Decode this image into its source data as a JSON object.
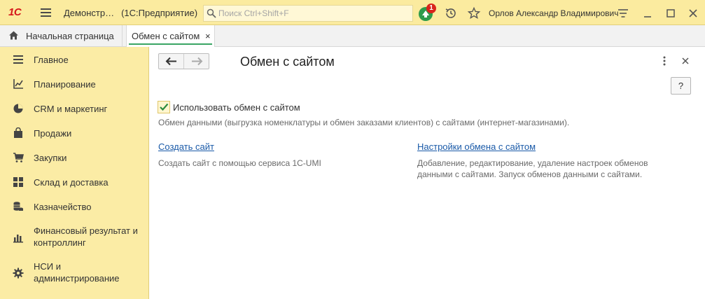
{
  "topbar": {
    "logo": "1С",
    "app_title": "Демонстр…",
    "app_subtitle": "(1С:Предприятие)",
    "search_placeholder": "Поиск Ctrl+Shift+F",
    "notification_count": "1",
    "user_name": "Орлов Александр Владимирович"
  },
  "tabs": {
    "home_label": "Начальная страница",
    "active_label": "Обмен с сайтом",
    "active_close": "×"
  },
  "sidebar": {
    "items": [
      {
        "label": "Главное",
        "icon": "menu-lines-icon"
      },
      {
        "label": "Планирование",
        "icon": "planning-chart-icon"
      },
      {
        "label": "CRM и маркетинг",
        "icon": "pie-chart-icon"
      },
      {
        "label": "Продажи",
        "icon": "shopping-bag-icon"
      },
      {
        "label": "Закупки",
        "icon": "cart-icon"
      },
      {
        "label": "Склад и доставка",
        "icon": "warehouse-grid-icon"
      },
      {
        "label": "Казначейство",
        "icon": "coins-icon"
      },
      {
        "label_line1": "Финансовый результат и",
        "label_line2": "контроллинг",
        "icon": "bar-chart-icon"
      },
      {
        "label_line1": "НСИ и",
        "label_line2": "администрирование",
        "icon": "gear-icon"
      }
    ]
  },
  "main": {
    "title": "Обмен с сайтом",
    "help_label": "?",
    "checkbox": {
      "checked": true,
      "label": "Использовать обмен с сайтом",
      "description": "Обмен данными (выгрузка номенклатуры и обмен заказами клиентов) с сайтами (интернет-магазинами)."
    },
    "create_site": {
      "link": "Создать сайт",
      "description": "Создать сайт с помощью сервиса 1С-UMI"
    },
    "exchange_settings": {
      "link": "Настройки обмена с сайтом",
      "description_line1": "Добавление, редактирование, удаление настроек обменов",
      "description_line2": "данными с сайтами. Запуск обменов данными с сайтами."
    }
  },
  "colors": {
    "topbar_bg": "#fbeb9f",
    "sidebar_bg": "#fbeca5",
    "accent_green": "#3aa564",
    "link_blue": "#1a5aa8",
    "badge_red": "#d9241c"
  }
}
